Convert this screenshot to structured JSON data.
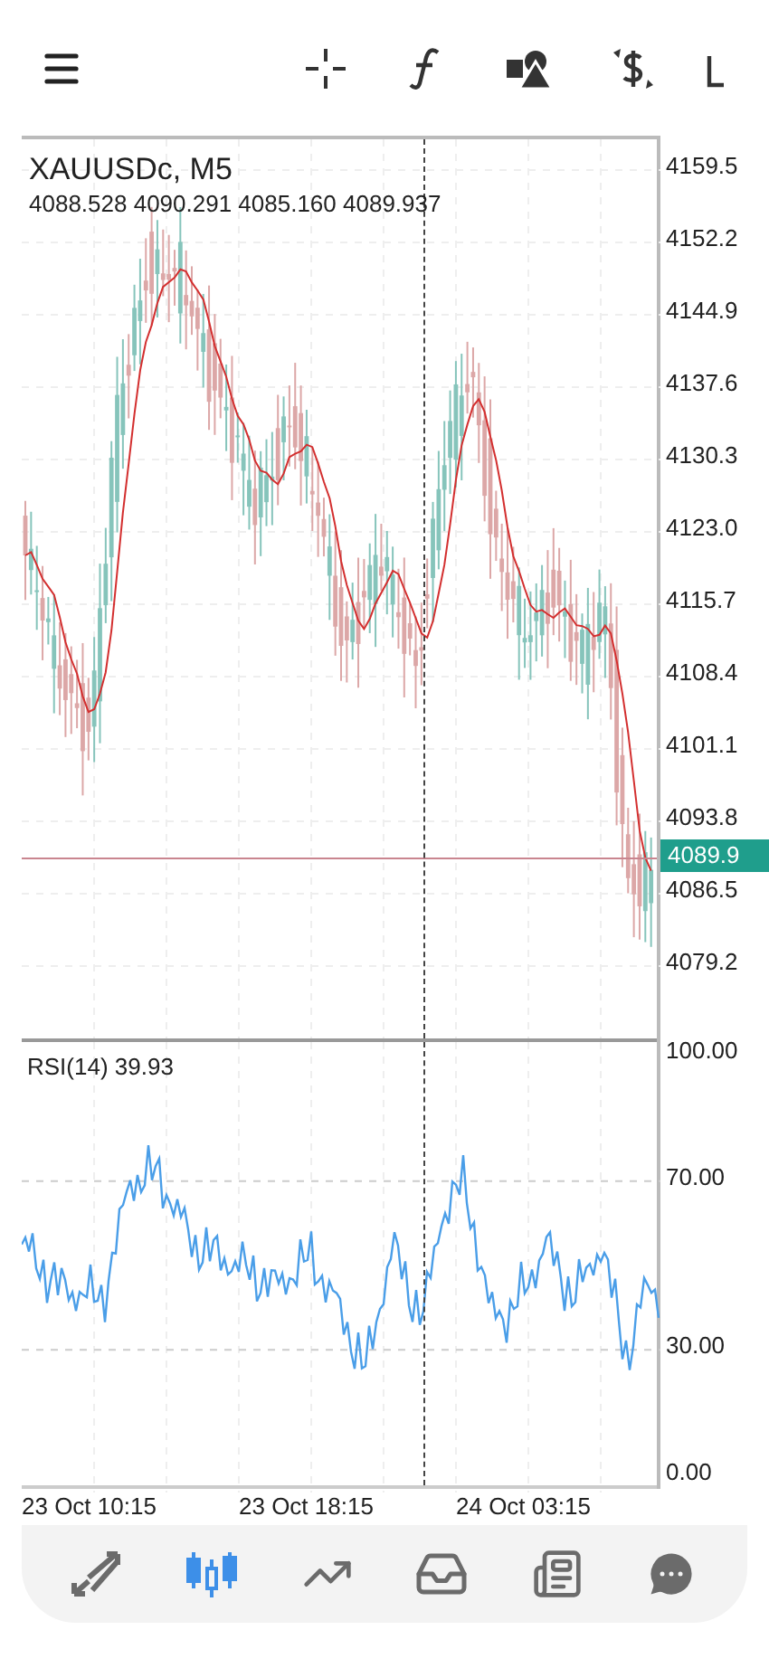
{
  "chart": {
    "symbol": "XAUUSDc, M5",
    "ohlc": "4088.528 4090.291 4085.160 4089.937",
    "price_labels": [
      "4159.5",
      "4152.2",
      "4144.9",
      "4137.6",
      "4130.3",
      "4123.0",
      "4115.7",
      "4108.4",
      "4101.1",
      "4093.8",
      "4086.5",
      "4079.2"
    ],
    "current_price": "4089.9"
  },
  "rsi": {
    "title": "RSI(14) 39.93",
    "labels": [
      "100.00",
      "70.00",
      "30.00",
      "0.00"
    ]
  },
  "time_labels": [
    "23 Oct 10:15",
    "23 Oct 18:15",
    "24 Oct 03:15"
  ],
  "nav": [
    {
      "kind": "trade",
      "selected": false
    },
    {
      "kind": "chart",
      "selected": true
    },
    {
      "kind": "history",
      "selected": false
    },
    {
      "kind": "inbox",
      "selected": false
    },
    {
      "kind": "news",
      "selected": false
    },
    {
      "kind": "chat",
      "selected": false
    }
  ]
}
